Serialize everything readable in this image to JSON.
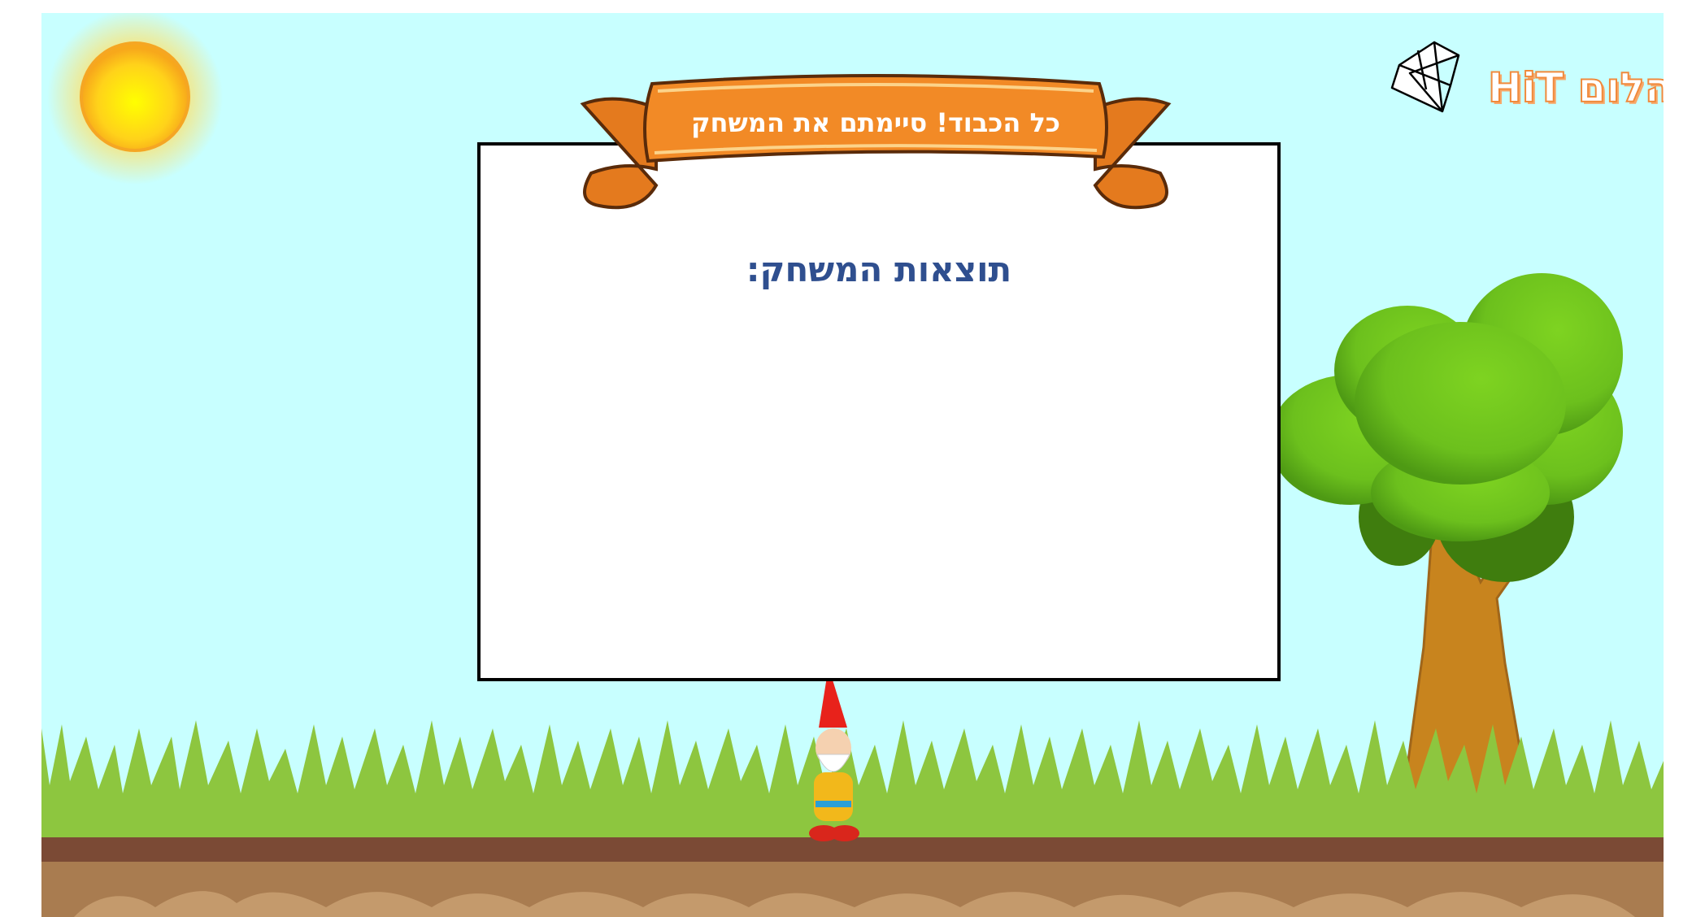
{
  "banner": {
    "title": "כל הכבוד! סיימתם את המשחק"
  },
  "results": {
    "heading": "תוצאות המשחק:"
  },
  "logo": {
    "text": "ביהלום HiT"
  },
  "colors": {
    "sky": "#c8ffff",
    "banner": "#f28a26",
    "heading": "#2f4f8f",
    "grass": "#8dc63f",
    "soil": "#a97c50"
  }
}
